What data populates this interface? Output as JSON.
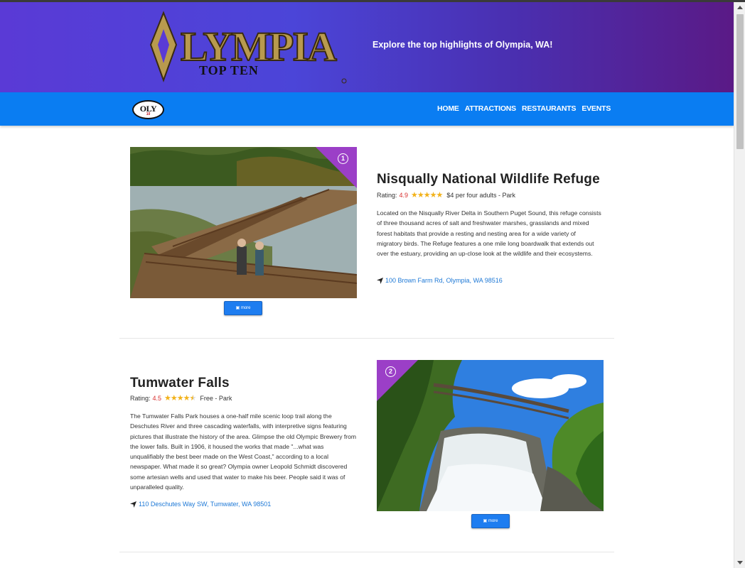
{
  "header": {
    "logo_main": "OLYMPIA",
    "logo_sub": "TOP TEN",
    "tagline": "Explore the top highlights of Olympia, WA!"
  },
  "navbar": {
    "badge_text": "OLY",
    "badge_sub": "10",
    "links": [
      "HOME",
      "ATTRACTIONS",
      "RESTAURANTS",
      "EVENTS"
    ]
  },
  "listings": [
    {
      "rank": "1",
      "title": "Nisqually National Wildlife Refuge",
      "rating_label": "Rating:",
      "rating": "4.9",
      "rating_stars": 5,
      "price_type": "$4 per four adults - Park",
      "description": "Located on the Nisqually River Delta in Southern Puget Sound, this refuge consists of three thousand acres of salt and freshwater marshes, grasslands and mixed forest habitats that provide a resting and nesting area for a wide variety of migratory birds. The Refuge features a one mile long boardwalk that extends out over the estuary, providing an up-close look at the wildlife and their ecosystems.",
      "address": "100 Brown Farm Rd, Olympia, WA 98516",
      "more_label": "more"
    },
    {
      "rank": "2",
      "title": "Tumwater Falls",
      "rating_label": "Rating:",
      "rating": "4.5",
      "rating_stars": 4.5,
      "price_type": "Free - Park",
      "description": "The Tumwater Falls Park houses a one-half mile scenic loop trail along the Deschutes River and three cascading waterfalls, with interpretive signs featuring pictures that illustrate the history of the area. Glimpse the old Olympic Brewery from the lower falls. Built in 1906, it housed the works that made \"...what was unqualifiably the best beer made on the West Coast,\" according to a local newspaper. What made it so great? Olympia owner Leopold Schmidt discovered some artesian wells and used that water to make his beer. People said it was of unparalleled quality.",
      "address": "110 Deschutes Way SW, Tumwater, WA 98501",
      "more_label": "more"
    }
  ],
  "colors": {
    "nav_blue": "#0a7df2",
    "rank_purple": "#9b3fc7",
    "rating_red": "#d9302f",
    "star_gold": "#f2b21a",
    "link_blue": "#1d78d6"
  }
}
